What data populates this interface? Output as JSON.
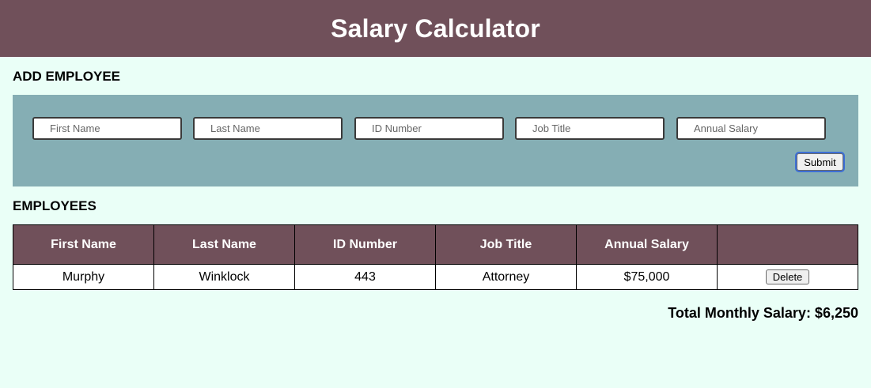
{
  "header": {
    "title": "Salary Calculator"
  },
  "add_section": {
    "heading": "ADD EMPLOYEE"
  },
  "form": {
    "fields": [
      {
        "placeholder": "First Name",
        "value": ""
      },
      {
        "placeholder": "Last Name",
        "value": ""
      },
      {
        "placeholder": "ID Number",
        "value": ""
      },
      {
        "placeholder": "Job Title",
        "value": ""
      },
      {
        "placeholder": "Annual Salary",
        "value": ""
      }
    ],
    "submit_label": "Submit"
  },
  "employees_section": {
    "heading": "EMPLOYEES"
  },
  "table": {
    "columns": [
      "First Name",
      "Last Name",
      "ID Number",
      "Job Title",
      "Annual Salary",
      ""
    ],
    "rows": [
      {
        "first_name": "Murphy",
        "last_name": "Winklock",
        "id_number": "443",
        "job_title": "Attorney",
        "annual_salary": "$75,000",
        "delete_label": "Delete"
      }
    ]
  },
  "total": {
    "text": "Total Monthly Salary: $6,250"
  },
  "colors": {
    "header_bg": "#70505a",
    "page_bg": "#eafff7",
    "form_bg": "#85aeb4",
    "focus_ring": "#3d6fd6"
  }
}
